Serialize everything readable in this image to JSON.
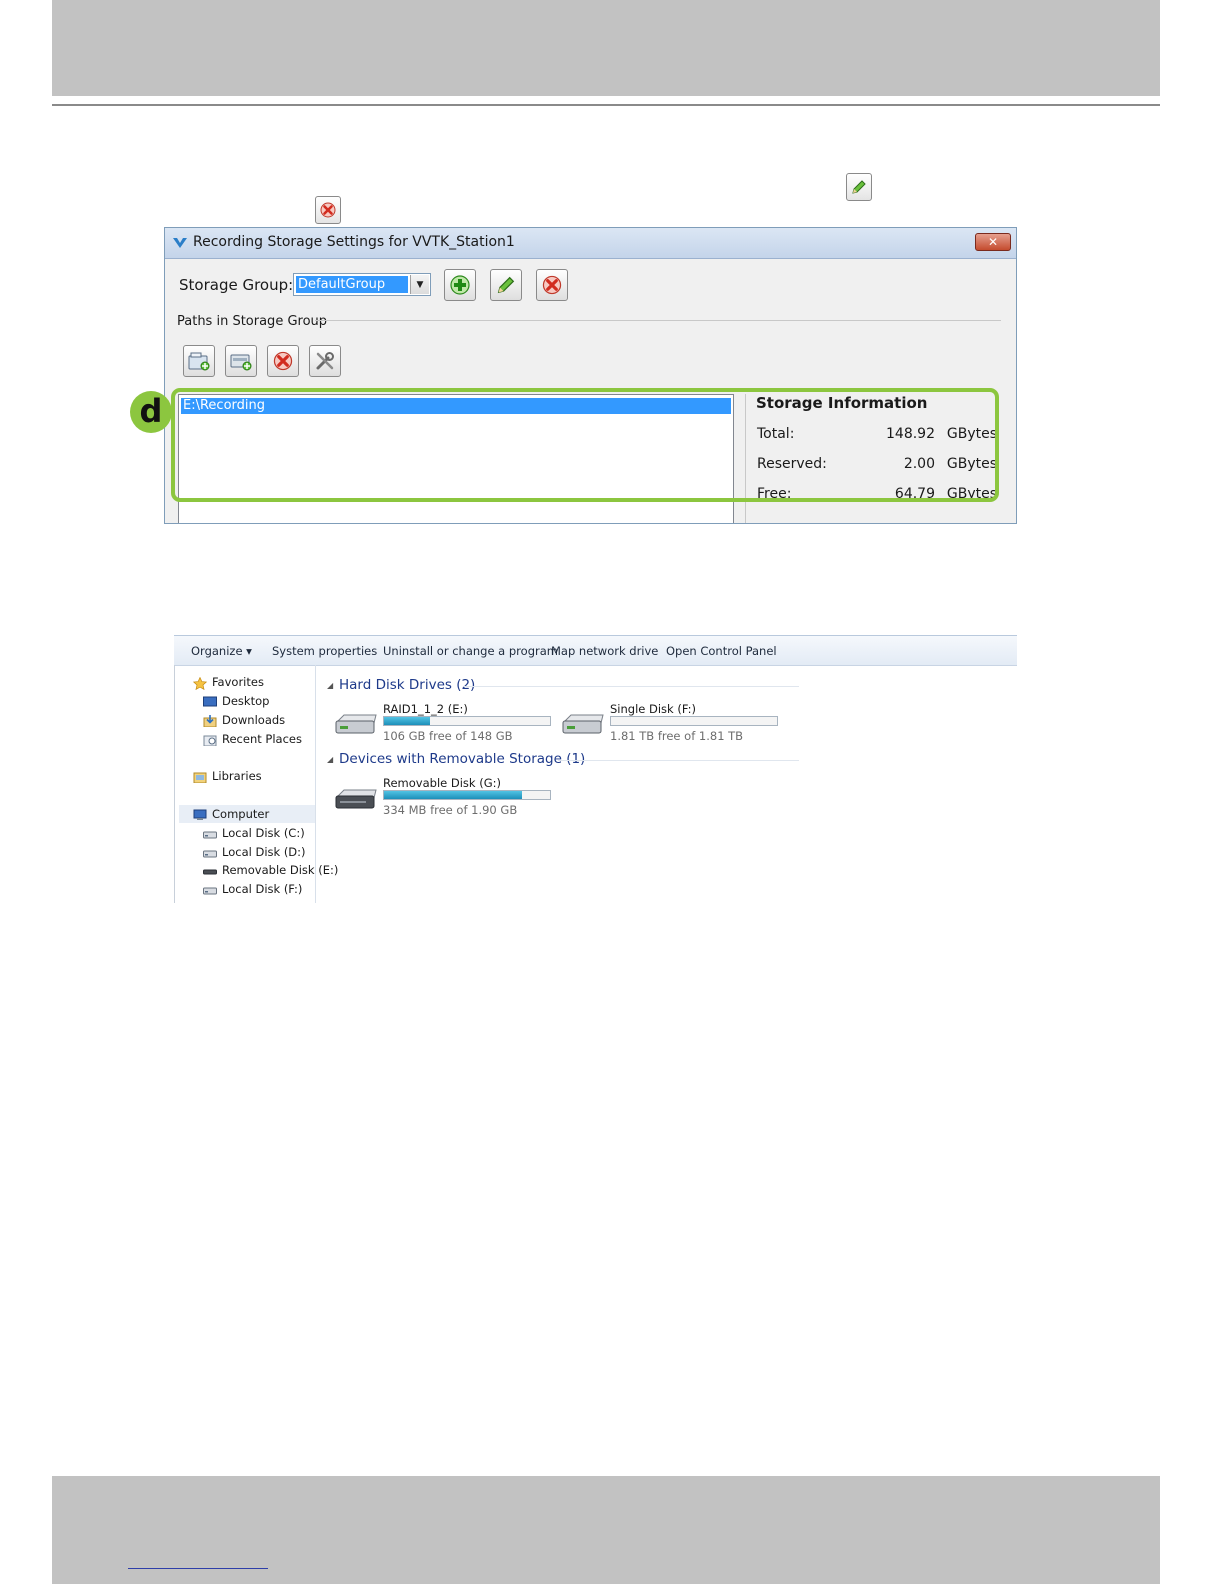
{
  "dialog": {
    "title": "Recording Storage Settings for VVTK_Station1",
    "storage_group_label": "Storage Group:",
    "storage_group_value": "DefaultGroup",
    "paths_label": "Paths in Storage Group",
    "path_items": [
      "E:\\Recording"
    ],
    "storage_info": {
      "title": "Storage Information",
      "rows": [
        {
          "label": "Total:",
          "value": "148.92",
          "unit": "GBytes"
        },
        {
          "label": "Reserved:",
          "value": "2.00",
          "unit": "GBytes"
        },
        {
          "label": "Free:",
          "value": "64.79",
          "unit": "GBytes"
        }
      ]
    },
    "callout_letter": "d",
    "highlight_color": "#8cc63f"
  },
  "explorer": {
    "toolbar": [
      "Organize ▾",
      "System properties",
      "Uninstall or change a program",
      "Map network drive",
      "Open Control Panel"
    ],
    "nav": {
      "favorites": "Favorites",
      "desktop": "Desktop",
      "downloads": "Downloads",
      "recent_places": "Recent Places",
      "libraries": "Libraries",
      "computer": "Computer",
      "drives": [
        "Local Disk (C:)",
        "Local Disk (D:)",
        "Removable Disk (E:)",
        "Local Disk (F:)"
      ]
    },
    "hard_disk_group": "Hard Disk Drives (2)",
    "removable_group": "Devices with Removable Storage (1)",
    "drives": [
      {
        "name": "RAID1_1_2 (E:)",
        "free_text": "106 GB free of 148 GB",
        "used_fraction": 0.28
      },
      {
        "name": "Single Disk (F:)",
        "free_text": "1.81 TB free of 1.81 TB",
        "used_fraction": 0.0
      },
      {
        "name": "Removable Disk (G:)",
        "free_text": "334 MB free of 1.90 GB",
        "used_fraction": 0.83
      }
    ]
  }
}
